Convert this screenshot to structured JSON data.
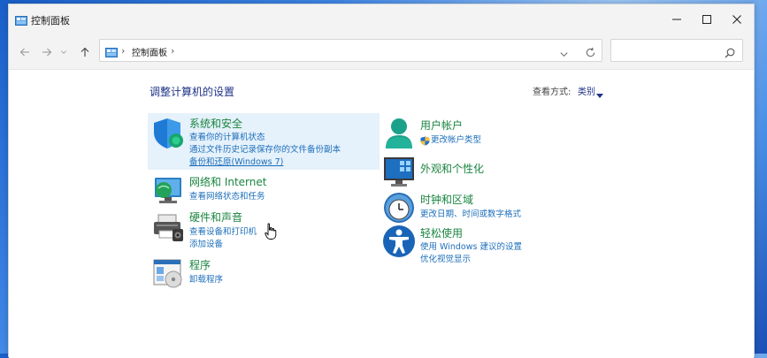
{
  "window": {
    "title": "控制面板"
  },
  "addressbar": {
    "breadcrumb": "控制面板",
    "search_placeholder": ""
  },
  "content": {
    "heading": "调整计算机的设置",
    "view_by_label": "查看方式:",
    "view_by_value": "类别"
  },
  "categories": {
    "system": {
      "title": "系统和安全",
      "links": [
        "查看你的计算机状态",
        "通过文件历史记录保存你的文件备份副本",
        "备份和还原(Windows 7)"
      ]
    },
    "network": {
      "title": "网络和 Internet",
      "links": [
        "查看网络状态和任务"
      ]
    },
    "hardware": {
      "title": "硬件和声音",
      "links": [
        "查看设备和打印机",
        "添加设备"
      ]
    },
    "programs": {
      "title": "程序",
      "links": [
        "卸载程序"
      ]
    },
    "users": {
      "title": "用户帐户",
      "links": [
        "更改帐户类型"
      ]
    },
    "appearance": {
      "title": "外观和个性化",
      "links": []
    },
    "clock": {
      "title": "时钟和区域",
      "links": [
        "更改日期、时间或数字格式"
      ]
    },
    "ease": {
      "title": "轻松使用",
      "links": [
        "使用 Windows 建议的设置",
        "优化视觉显示"
      ]
    }
  },
  "colors": {
    "category_title": "#1a8540",
    "link": "#1e6fba",
    "heading": "#1e3287",
    "highlight": "#e5f1fb"
  }
}
